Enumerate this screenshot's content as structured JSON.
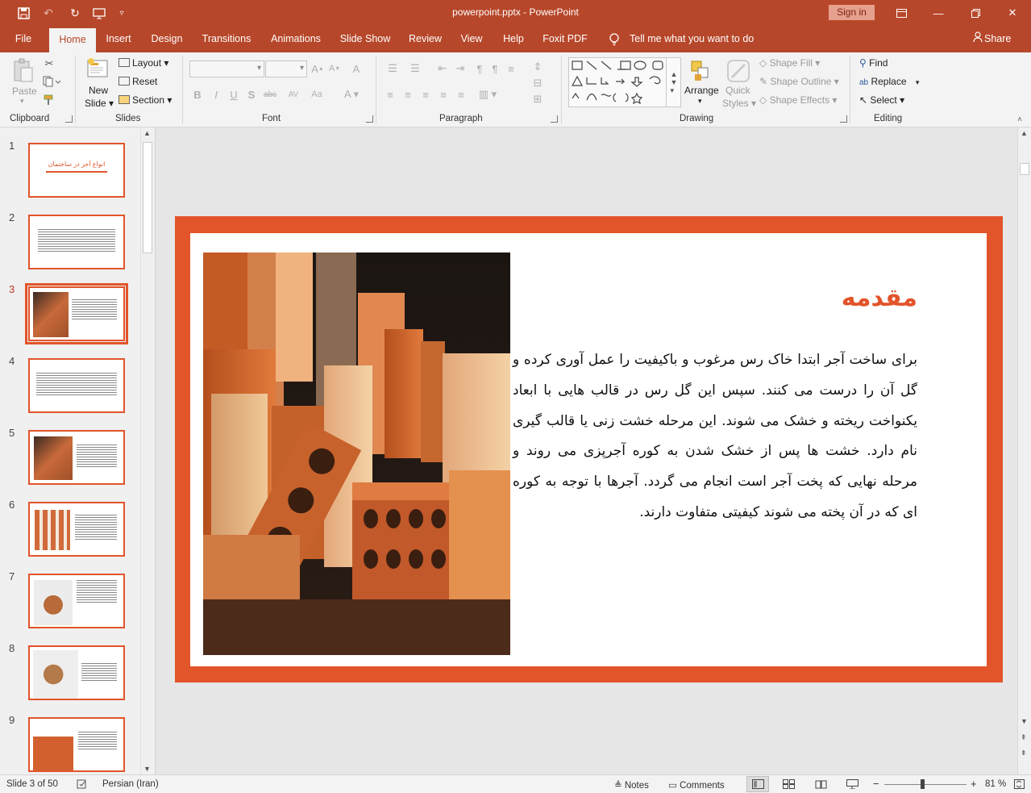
{
  "window": {
    "title": "powerpoint.pptx  -  PowerPoint",
    "signin_label": "Sign in",
    "accent_color": "#b7472a",
    "slide_accent_color": "#e2542a"
  },
  "quick_access": [
    "save-icon",
    "undo-icon",
    "redo-icon",
    "present-from-start-icon",
    "customize-icon"
  ],
  "tabs": {
    "file": "File",
    "home": "Home",
    "insert": "Insert",
    "design": "Design",
    "transitions": "Transitions",
    "animations": "Animations",
    "slideshow": "Slide Show",
    "review": "Review",
    "view": "View",
    "help": "Help",
    "foxit": "Foxit PDF",
    "tell": "Tell me what you want to do",
    "share": "Share"
  },
  "ribbon": {
    "clipboard": {
      "label": "Clipboard",
      "paste": "Paste"
    },
    "slides": {
      "label": "Slides",
      "new_slide_1": "New",
      "new_slide_2": "Slide",
      "layout": "Layout",
      "reset": "Reset",
      "section": "Section"
    },
    "font": {
      "label": "Font"
    },
    "paragraph": {
      "label": "Paragraph"
    },
    "drawing": {
      "label": "Drawing",
      "arrange": "Arrange",
      "quick_1": "Quick",
      "quick_2": "Styles",
      "shape_fill": "Shape Fill",
      "shape_outline": "Shape Outline",
      "shape_effects": "Shape Effects"
    },
    "editing": {
      "label": "Editing",
      "find": "Find",
      "replace": "Replace",
      "select": "Select"
    }
  },
  "thumbnails": [
    {
      "num": "1",
      "title": "انواع آجر در ساختمان"
    },
    {
      "num": "2"
    },
    {
      "num": "3"
    },
    {
      "num": "4"
    },
    {
      "num": "5"
    },
    {
      "num": "6"
    },
    {
      "num": "7"
    },
    {
      "num": "8"
    },
    {
      "num": "9"
    }
  ],
  "selected_slide": "3",
  "slide": {
    "title": "مقدمه",
    "body": "برای ساخت آجر ابتدا خاک رس مرغوب و باکیفیت را عمل آوری کرده و گل آن را درست می کنند. سپس این گل رس در قالب هایی با ابعاد یکنواخت ریخته و خشک می شوند. این مرحله خشت زنی یا قالب گیری نام دارد. خشت ها پس از خشک شدن به کوره آجرپزی می روند و مرحله نهایی که پخت آجر است انجام می گردد. آجرها با توجه به کوره ای که در آن پخته می شوند کیفیتی متفاوت دارند."
  },
  "status": {
    "slide_info": "Slide 3 of 50",
    "language": "Persian (Iran)",
    "notes": "Notes",
    "comments": "Comments",
    "zoom_minus": "−",
    "zoom_plus": "+",
    "zoom": "81 %",
    "zoom_fraction": 0.46
  }
}
